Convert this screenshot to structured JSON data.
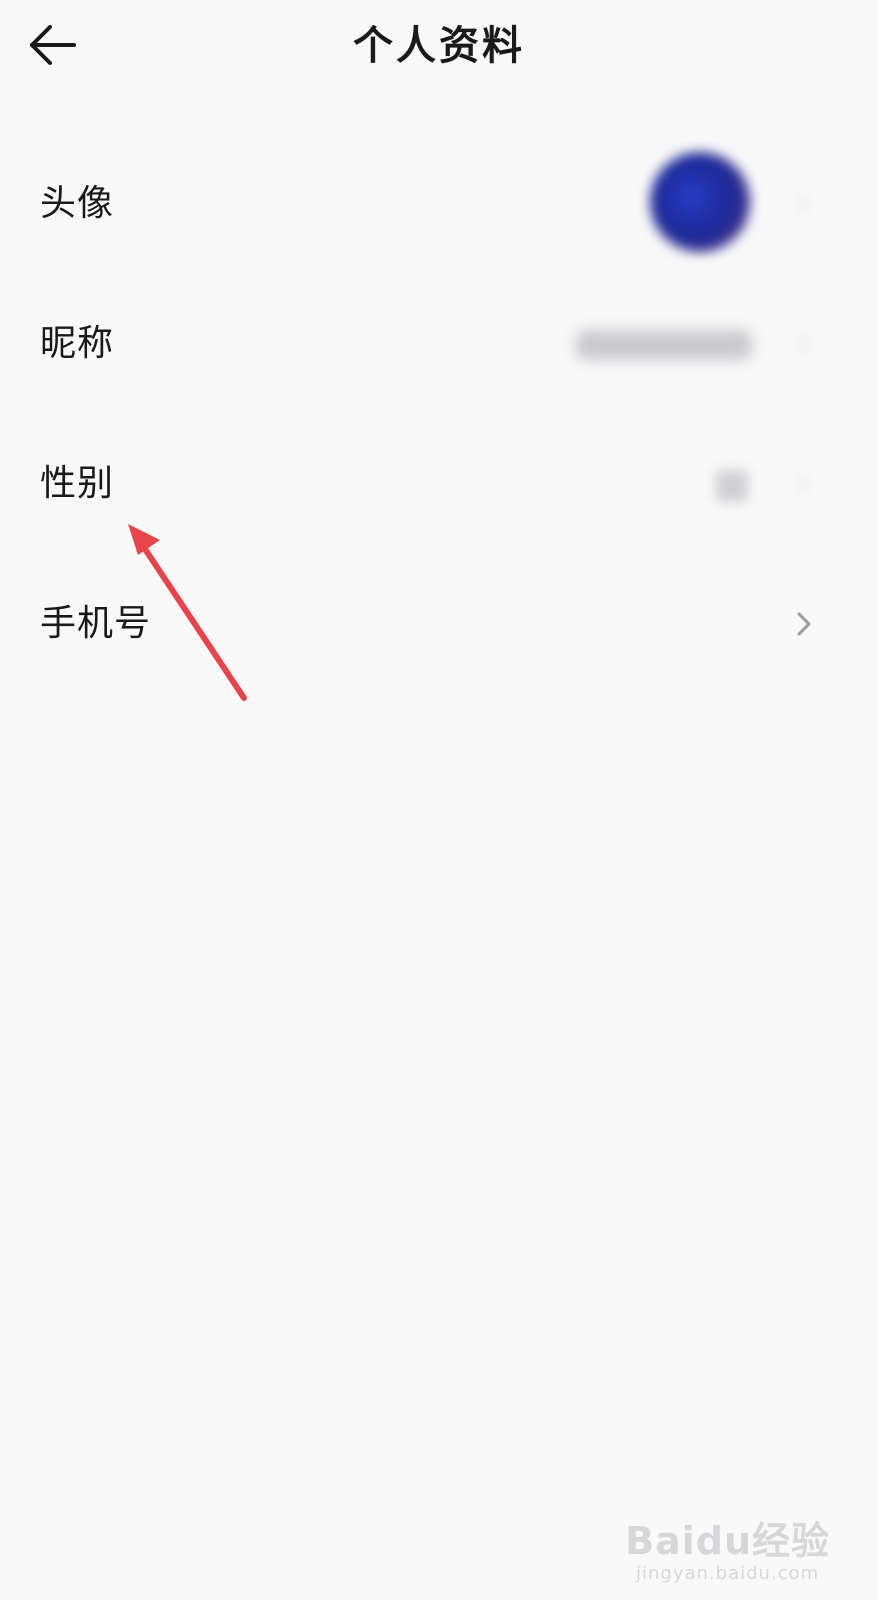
{
  "header": {
    "title": "个人资料",
    "back_icon": "arrow-left-icon"
  },
  "rows": [
    {
      "key": "avatar",
      "label": "头像"
    },
    {
      "key": "nickname",
      "label": "昵称"
    },
    {
      "key": "gender",
      "label": "性别"
    },
    {
      "key": "phone",
      "label": "手机号"
    }
  ],
  "icons": {
    "chevron": "chevron-right-icon"
  },
  "annotation": {
    "color": "#e8454b"
  },
  "watermark": {
    "logo": "Baidu经验",
    "url": "jingyan.baidu.com"
  }
}
